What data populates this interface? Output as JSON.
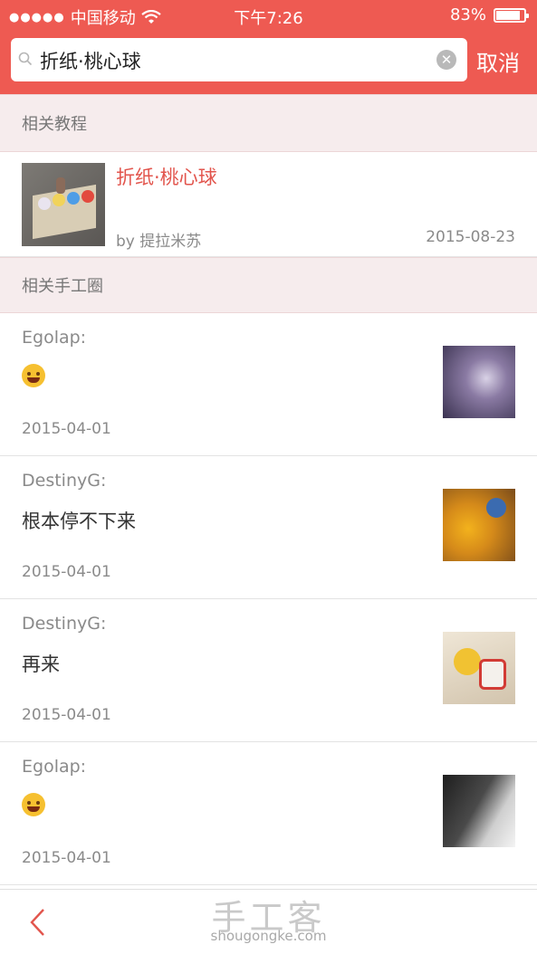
{
  "status_bar": {
    "signal_dots": "●●●●●",
    "carrier": "中国移动",
    "wifi_icon": "wifi-icon",
    "time": "下午7:26",
    "battery": "83%"
  },
  "search": {
    "query": "折纸·桃心球",
    "cancel_label": "取消",
    "icons": [
      "search-icon",
      "clear-icon"
    ]
  },
  "sections": {
    "tutorials_title": "相关教程",
    "circles_title": "相关手工圈"
  },
  "tutorial": {
    "title": "折纸·桃心球",
    "author": "by 提拉米苏",
    "date": "2015-08-23"
  },
  "posts": [
    {
      "author": "Egolap:",
      "content": "",
      "has_emoji": true,
      "date": "2015-04-01",
      "thumb_color": "#6b5c86"
    },
    {
      "author": "DestinyG:",
      "content": "根本停不下来",
      "has_emoji": false,
      "date": "2015-04-01",
      "thumb_color": "#c97a1f"
    },
    {
      "author": "DestinyG:",
      "content": "再来",
      "has_emoji": false,
      "date": "2015-04-01",
      "thumb_color": "#d9c9b0"
    },
    {
      "author": "Egolap:",
      "content": "",
      "has_emoji": true,
      "date": "2015-04-01",
      "thumb_color": "#555555"
    }
  ],
  "footer": {
    "back_icon": "back-chevron-icon",
    "watermark_cn": "手工客",
    "watermark_en": "shougongke.com"
  },
  "colors": {
    "brand": "#ee5a52",
    "section_bg": "#f6eced",
    "accent_text": "#e2554d"
  }
}
